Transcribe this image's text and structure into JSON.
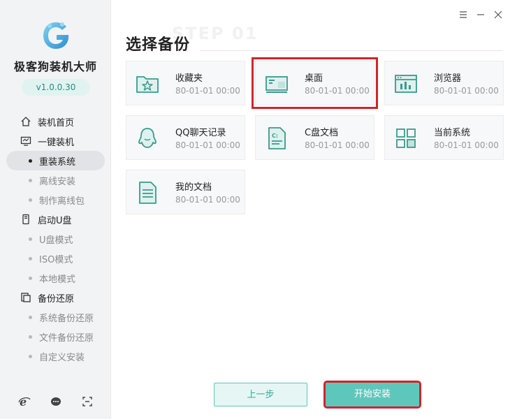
{
  "sidebar": {
    "app_name": "极客狗装机大师",
    "version": "v1.0.0.30",
    "groups": [
      {
        "label": "装机首页",
        "icon": "home-icon",
        "items": []
      },
      {
        "label": "一键装机",
        "icon": "monitor-icon",
        "items": [
          {
            "label": "重装系统",
            "active": true
          },
          {
            "label": "离线安装",
            "active": false
          },
          {
            "label": "制作离线包",
            "active": false
          }
        ]
      },
      {
        "label": "启动U盘",
        "icon": "usb-icon",
        "items": [
          {
            "label": "U盘模式",
            "active": false
          },
          {
            "label": "ISO模式",
            "active": false
          },
          {
            "label": "本地模式",
            "active": false
          }
        ]
      },
      {
        "label": "备份还原",
        "icon": "backup-icon",
        "items": [
          {
            "label": "系统备份还原",
            "active": false
          },
          {
            "label": "文件备份还原",
            "active": false
          },
          {
            "label": "自定义安装",
            "active": false
          }
        ]
      }
    ],
    "bottom_icons": [
      "ie-browser-icon",
      "chat-support-icon",
      "screenshot-icon"
    ]
  },
  "window": {
    "controls": [
      "menu-icon",
      "minimize-icon",
      "close-icon"
    ]
  },
  "main": {
    "ghost_text": "STEP 01",
    "title": "选择备份",
    "cards": [
      {
        "name": "收藏夹",
        "date": "80-01-01 00:00",
        "icon": "favorites-folder-icon",
        "selected": false
      },
      {
        "name": "桌面",
        "date": "80-01-01 00:00",
        "icon": "desktop-icon",
        "selected": true
      },
      {
        "name": "浏览器",
        "date": "80-01-01 00:00",
        "icon": "browser-icon",
        "selected": false
      },
      {
        "name": "QQ聊天记录",
        "date": "80-01-01 00:00",
        "icon": "qq-penguin-icon",
        "selected": false
      },
      {
        "name": "C盘文档",
        "date": "80-01-01 00:00",
        "icon": "c-drive-document-icon",
        "selected": false
      },
      {
        "name": "当前系统",
        "date": "80-01-01 00:00",
        "icon": "system-grid-icon",
        "selected": false
      },
      {
        "name": "我的文档",
        "date": "80-01-01 00:00",
        "icon": "my-documents-icon",
        "selected": false
      }
    ],
    "buttons": {
      "prev": "上一步",
      "start": "开始安装"
    }
  },
  "colors": {
    "accent": "#5ec7bb",
    "highlight": "#d0242b",
    "icon_teal": "#3a9a8e"
  }
}
